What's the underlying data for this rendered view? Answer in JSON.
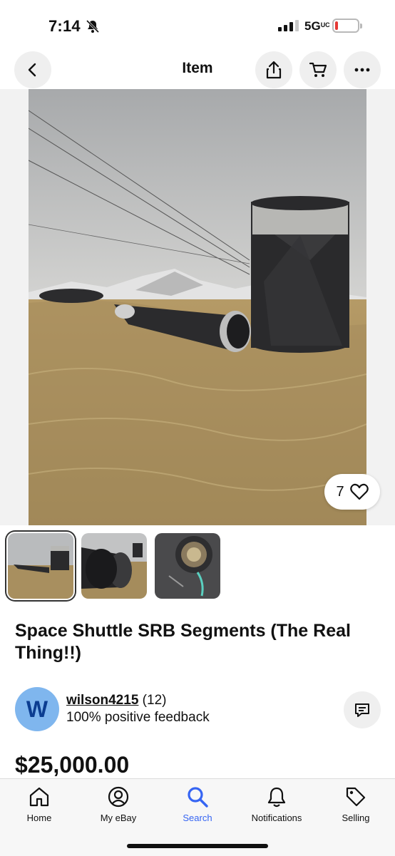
{
  "status_bar": {
    "time": "7:14",
    "network": "5G",
    "network_sub": "UC"
  },
  "nav": {
    "title": "Item"
  },
  "gallery": {
    "favorites_count": "7"
  },
  "listing": {
    "title": "Space Shuttle SRB Segments (The Real Thing!!)",
    "price": "$25,000.00",
    "seller": {
      "initial": "W",
      "username": "wilson4215",
      "rating_count": "(12)",
      "feedback": "100% positive feedback"
    }
  },
  "tabs": [
    {
      "label": "Home",
      "icon": "home-icon"
    },
    {
      "label": "My eBay",
      "icon": "profile-icon"
    },
    {
      "label": "Search",
      "icon": "search-icon"
    },
    {
      "label": "Notifications",
      "icon": "bell-icon"
    },
    {
      "label": "Selling",
      "icon": "tag-icon"
    }
  ],
  "colors": {
    "accent": "#3665f3",
    "avatar_bg": "#7fb6ee",
    "battery_low": "#e53935"
  }
}
